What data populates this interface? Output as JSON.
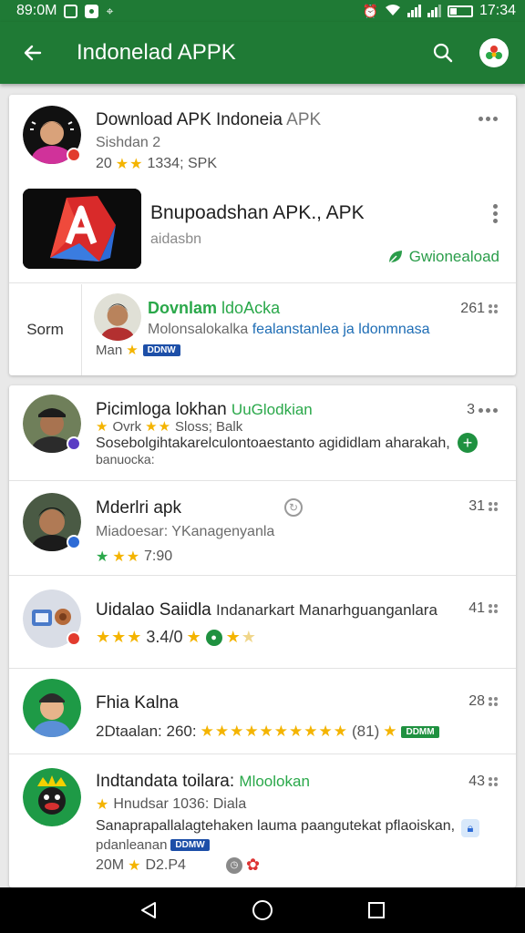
{
  "status": {
    "time_left": "89:0M",
    "time_right": "17:34"
  },
  "appbar": {
    "title": "Indonelad APPK",
    "back_icon": "arrow-left-icon",
    "search_icon": "search-icon"
  },
  "colors": {
    "primary": "#1f7a35",
    "accent_green": "#2aa84a",
    "star": "#f4b400",
    "link_blue": "#1e6db5"
  },
  "card1": {
    "header": {
      "title_main": "Download APK Indoneia",
      "title_suffix": "APK",
      "subtitle": "Sishdan 2",
      "meta_prefix": "20",
      "meta_suffix": "1334; SPK"
    },
    "app": {
      "title": "Bnupoadshan APK., APK",
      "subtitle": "aidasbn",
      "download_label": "Gwioneaload"
    },
    "feature": {
      "side_label": "Sorm",
      "title_a": "Dovnlam",
      "title_b": "ldoAcka",
      "desc_a": "Molonsalokalka",
      "desc_b": "fealanstanlea ja ldonmnasa",
      "meta_text": "Man",
      "pill": "DDNW",
      "count": "261"
    }
  },
  "list": [
    {
      "title_a": "Picimloga lokhan",
      "title_b": "UuGlodkian",
      "sub_a": "Ovrk",
      "sub_b": "Sloss; Balk",
      "desc": "Sosebolgihtakarelculontoaestanto agididlam aharakah,",
      "desc2": "banuocka:",
      "count": "3",
      "right_icon": "plus-circle-icon"
    },
    {
      "title_a": "Mderlri apk",
      "sub_a": "Miadoesar: YKanagenyanla",
      "rating": "7:90",
      "count": "31",
      "right_icon": "sync-icon"
    },
    {
      "title_a": "Uidalao Saiidla",
      "title_b": "Indanarkart Manarhguanganlara",
      "rating": "3.4/0",
      "count": "41"
    },
    {
      "title_a": "Fhia Kalna",
      "meta_a": "2Dtaalan: 260:",
      "meta_b": "(81)",
      "pill": "DDMM",
      "count": "28"
    },
    {
      "title_a": "Indtandata toilara:",
      "title_b": "Mloolokan",
      "sub_b": "Hnudsar 1036: Diala",
      "desc": "Sanaprapallalagtehaken lauma paangutekat pflaoiskan,",
      "desc2": "pdanleanan",
      "pill": "DDMW",
      "meta_a": "20M",
      "meta_b": "D2.P4",
      "count": "43",
      "right_icon": "lock-icon"
    }
  ]
}
